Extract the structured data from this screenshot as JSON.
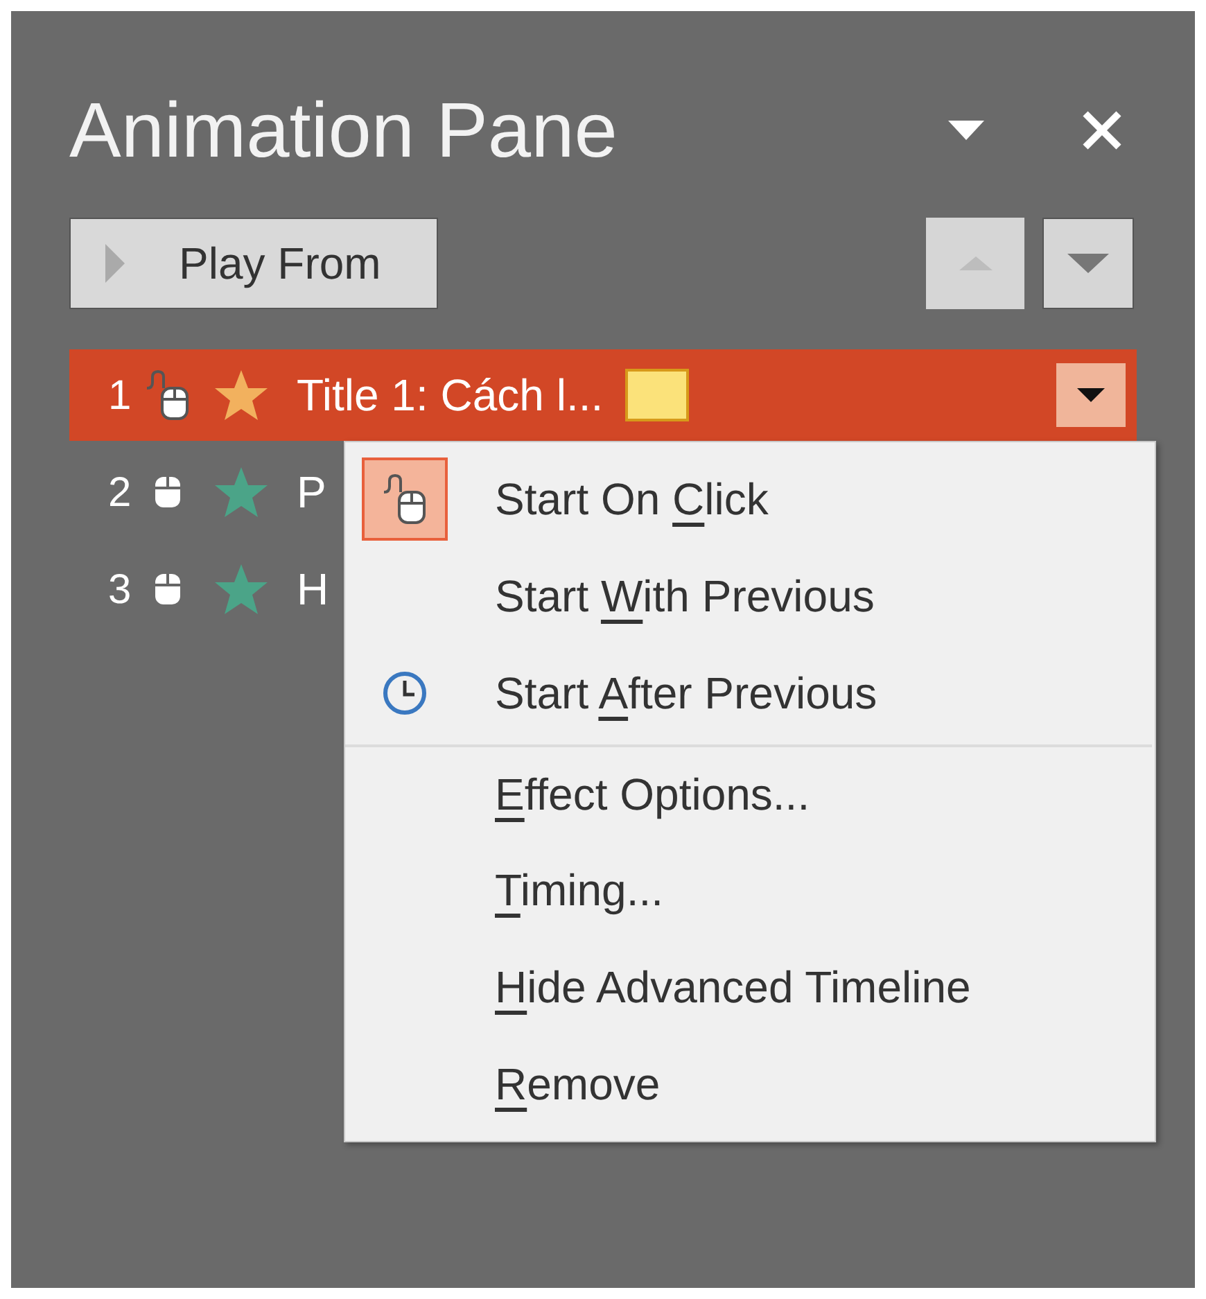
{
  "pane": {
    "title": "Animation Pane",
    "play_button": "Play From"
  },
  "items": [
    {
      "number": "1",
      "kind": "on_click",
      "color": "#f2b15e",
      "label": "Title 1: Cách l...",
      "timeline_bar": true,
      "selected": true
    },
    {
      "number": "2",
      "kind": "click",
      "color": "#4ba488",
      "label": "P",
      "selected": false
    },
    {
      "number": "3",
      "kind": "click",
      "color": "#4ba488",
      "label": "H",
      "selected": false
    }
  ],
  "context_menu": [
    {
      "kind": "mouse",
      "prefix": "Start On ",
      "access_key": "C",
      "suffix": "lick",
      "selected": true,
      "separator_before": false
    },
    {
      "kind": "plain",
      "prefix": "Start ",
      "access_key": "W",
      "suffix": "ith Previous",
      "selected": false,
      "separator_before": false
    },
    {
      "kind": "clock",
      "prefix": "Start ",
      "access_key": "A",
      "suffix": "fter Previous",
      "selected": false,
      "separator_before": false
    },
    {
      "kind": "plain",
      "access_key": "E",
      "suffix": "ffect Options...",
      "selected": false,
      "separator_before": true
    },
    {
      "kind": "plain",
      "access_key": "T",
      "suffix": "iming...",
      "selected": false,
      "separator_before": false
    },
    {
      "kind": "plain",
      "access_key": "H",
      "suffix": "ide Advanced Timeline",
      "selected": false,
      "separator_before": false
    },
    {
      "kind": "plain",
      "access_key": "R",
      "suffix": "emove",
      "selected": false,
      "separator_before": false
    }
  ]
}
